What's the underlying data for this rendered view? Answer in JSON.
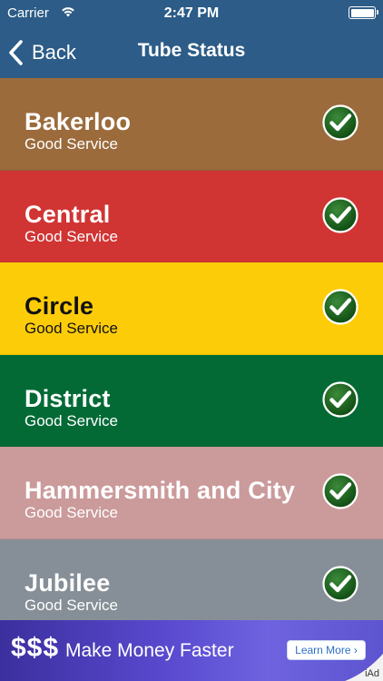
{
  "status_bar": {
    "carrier": "Carrier",
    "time": "2:47 PM",
    "wifi_icon": "wifi-icon",
    "battery_icon": "battery-icon"
  },
  "nav": {
    "back_label": "Back",
    "title": "Tube Status",
    "back_icon": "chevron-left-icon",
    "background": "#2c5c87"
  },
  "lines": [
    {
      "name": "Bakerloo",
      "status": "Good Service",
      "color": "#9b6b3c",
      "text_color": "#ffffff",
      "icon": "check-circle-icon"
    },
    {
      "name": "Central",
      "status": "Good Service",
      "color": "#d03433",
      "text_color": "#ffffff",
      "icon": "check-circle-icon"
    },
    {
      "name": "Circle",
      "status": "Good Service",
      "color": "#fdcc09",
      "text_color": "#111111",
      "icon": "check-circle-icon"
    },
    {
      "name": "District",
      "status": "Good Service",
      "color": "#036a36",
      "text_color": "#ffffff",
      "icon": "check-circle-icon"
    },
    {
      "name": "Hammersmith and City",
      "status": "Good Service",
      "color": "#cb9a9b",
      "text_color": "#ffffff",
      "icon": "check-circle-icon"
    },
    {
      "name": "Jubilee",
      "status": "Good Service",
      "color": "#868f97",
      "text_color": "#ffffff",
      "icon": "check-circle-icon"
    }
  ],
  "ad": {
    "dollars": "$$$",
    "text": "Make Money Faster",
    "button_label": "Learn More ›",
    "badge": "iAd"
  }
}
